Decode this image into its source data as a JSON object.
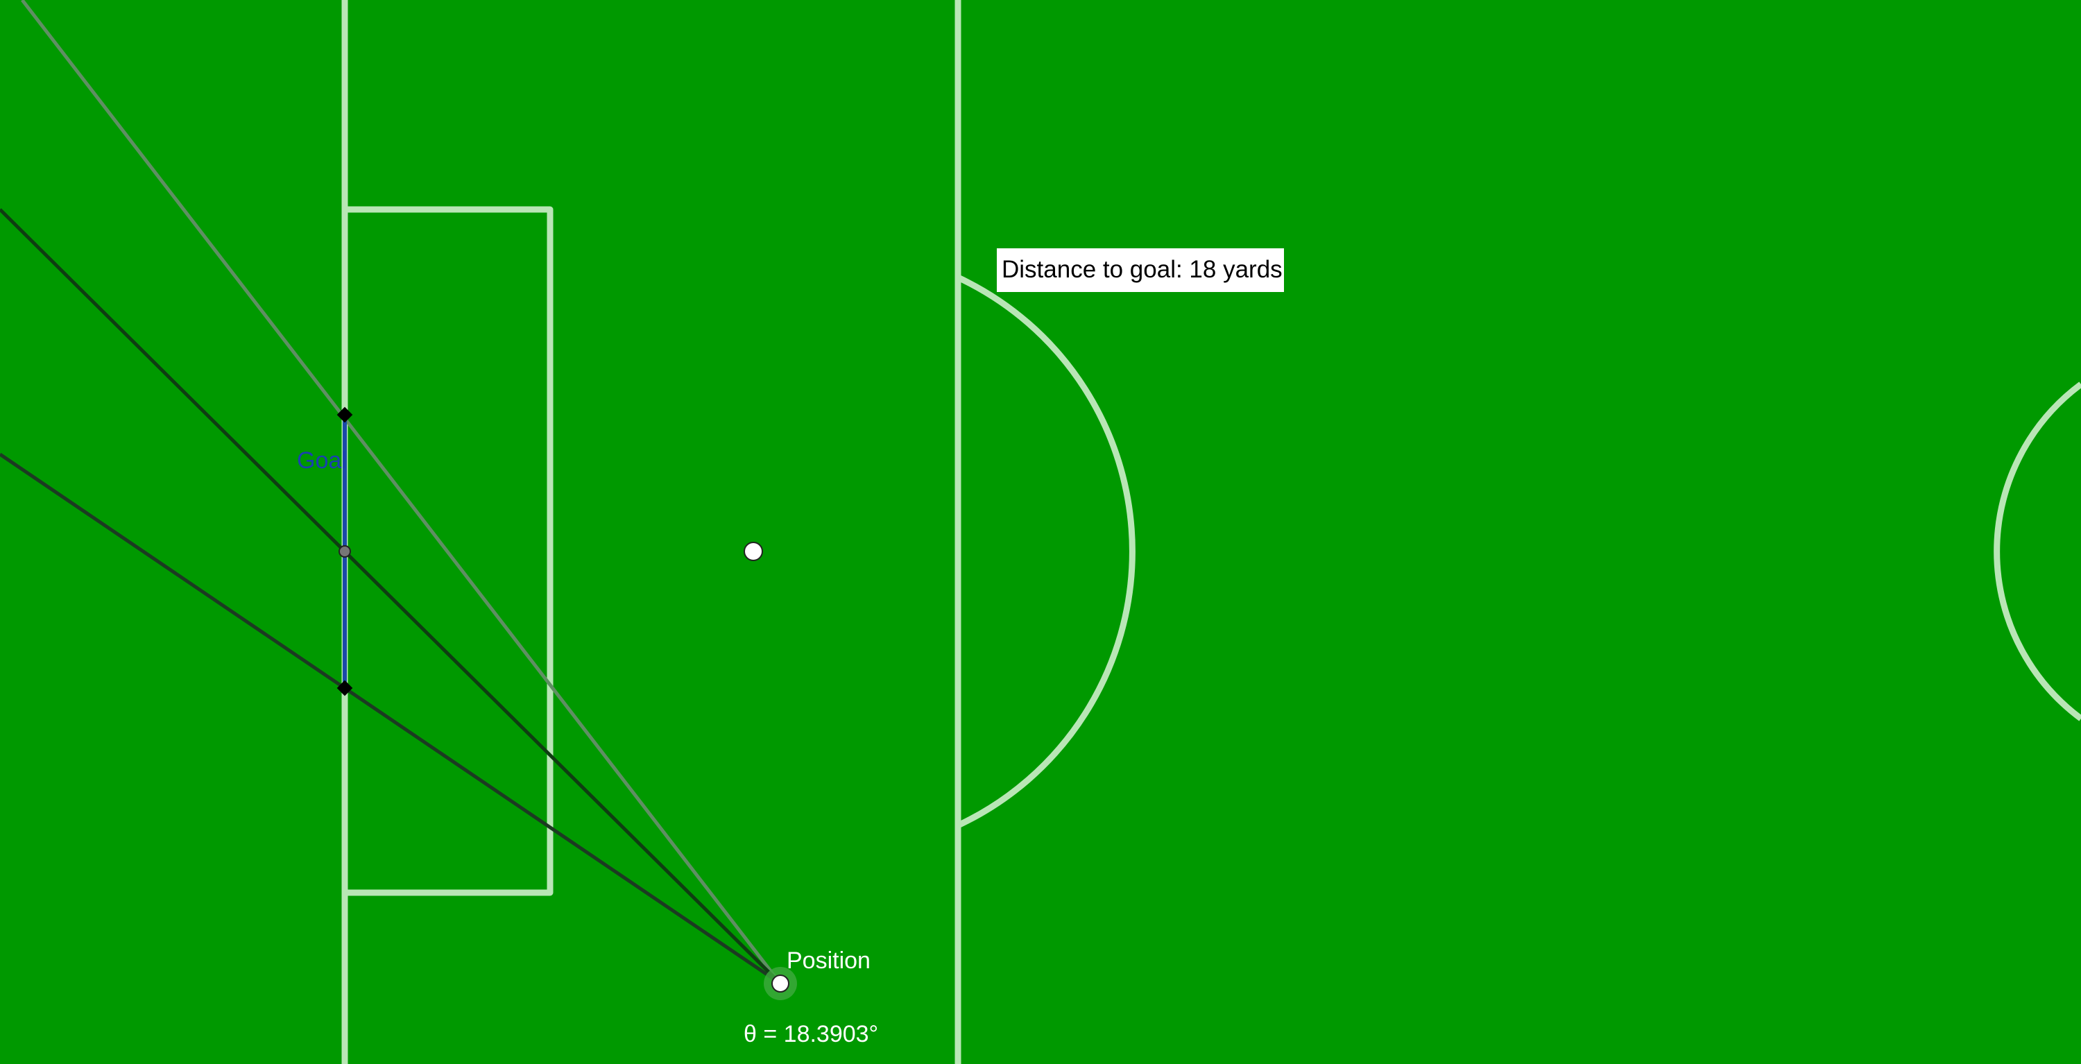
{
  "labels": {
    "distance_box": "Distance to goal: 18 yards",
    "position": "Position",
    "goal": "Goal",
    "angle": "θ = 18.3903°"
  },
  "colors": {
    "field": "#009900",
    "field_lines": "#b9e6b6",
    "goal_line": "#1a4aa8",
    "goal_label": "#1a40b0",
    "ray_dark": "#0f3d12",
    "ray_mid": "#1c3a22",
    "ray_light": "#5f8f63",
    "label_box_bg": "#ffffff",
    "text_light": "#ffffff"
  }
}
